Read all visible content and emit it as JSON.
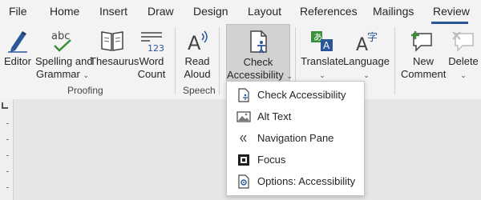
{
  "tabs": [
    "File",
    "Home",
    "Insert",
    "Draw",
    "Design",
    "Layout",
    "References",
    "Mailings",
    "Review"
  ],
  "active_tab": "Review",
  "accent_color": "#2b579a",
  "ribbon": {
    "editor": {
      "label": "Editor",
      "icon": "editor-pen-icon"
    },
    "spelling": {
      "line1": "Spelling and",
      "line2": "Grammar",
      "icon": "spelling-abc-check-icon"
    },
    "thesaurus": {
      "label": "Thesaurus",
      "icon": "book-icon"
    },
    "word_count": {
      "line1": "Word",
      "line2": "Count",
      "icon": "word-count-123-icon"
    },
    "read_aloud": {
      "line1": "Read",
      "line2": "Aloud",
      "icon": "read-aloud-icon"
    },
    "check_accessibility": {
      "line1": "Check",
      "line2": "Accessibility",
      "icon": "accessibility-doc-icon"
    },
    "translate": {
      "label": "Translate",
      "icon": "translate-icon"
    },
    "language": {
      "label": "Language",
      "icon": "language-icon"
    },
    "new_comment": {
      "line1": "New",
      "line2": "Comment",
      "icon": "new-comment-icon"
    },
    "delete": {
      "label": "Delete",
      "icon": "delete-comment-icon"
    },
    "groups": {
      "proofing": "Proofing",
      "speech": "Speech"
    }
  },
  "menu": {
    "items": [
      {
        "label": "Check Accessibility",
        "icon": "accessibility-doc-icon"
      },
      {
        "label": "Alt Text",
        "icon": "alt-text-icon"
      },
      {
        "label": "Navigation Pane",
        "icon": "double-chevron-left-icon"
      },
      {
        "label": "Focus",
        "icon": "focus-icon"
      },
      {
        "label": "Options: Accessibility",
        "icon": "options-accessibility-icon"
      }
    ]
  }
}
